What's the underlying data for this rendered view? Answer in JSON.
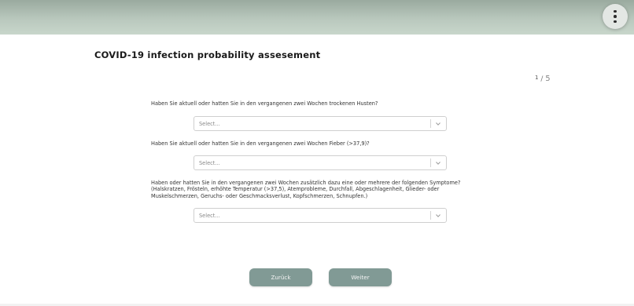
{
  "header": {
    "menu_icon": "more-vertical-icon"
  },
  "page": {
    "title": "COVID-19 infection probability assesement"
  },
  "pager": {
    "current": "1",
    "separator": "/",
    "total": "5"
  },
  "questions": [
    {
      "text": "Haben Sie aktuell oder hatten Sie in den vergangenen zwei Wochen trockenen Husten?",
      "placeholder": "Select..."
    },
    {
      "text": "Haben Sie aktuell oder hatten Sie in den vergangenen zwei Wochen Fieber (>37,9)?",
      "placeholder": "Select..."
    },
    {
      "text": "Haben oder hatten Sie in den vergangenen zwei Wochen zusätzlich dazu eine oder mehrere der folgenden Symptome? (Halskratzen, Frösteln, erhöhte Temperatur (>37,5), Atemprobleme, Durchfall, Abgeschlagenheit, Glieder- oder Muskelschmerzen, Geruchs- oder Geschmacksverlust, Kopfschmerzen, Schnupfen.)",
      "placeholder": "Select..."
    }
  ],
  "actions": {
    "back_label": "Zurück",
    "next_label": "Weiter"
  },
  "colors": {
    "button_bg": "#819a95",
    "header_bg": "#b9c8bd"
  }
}
